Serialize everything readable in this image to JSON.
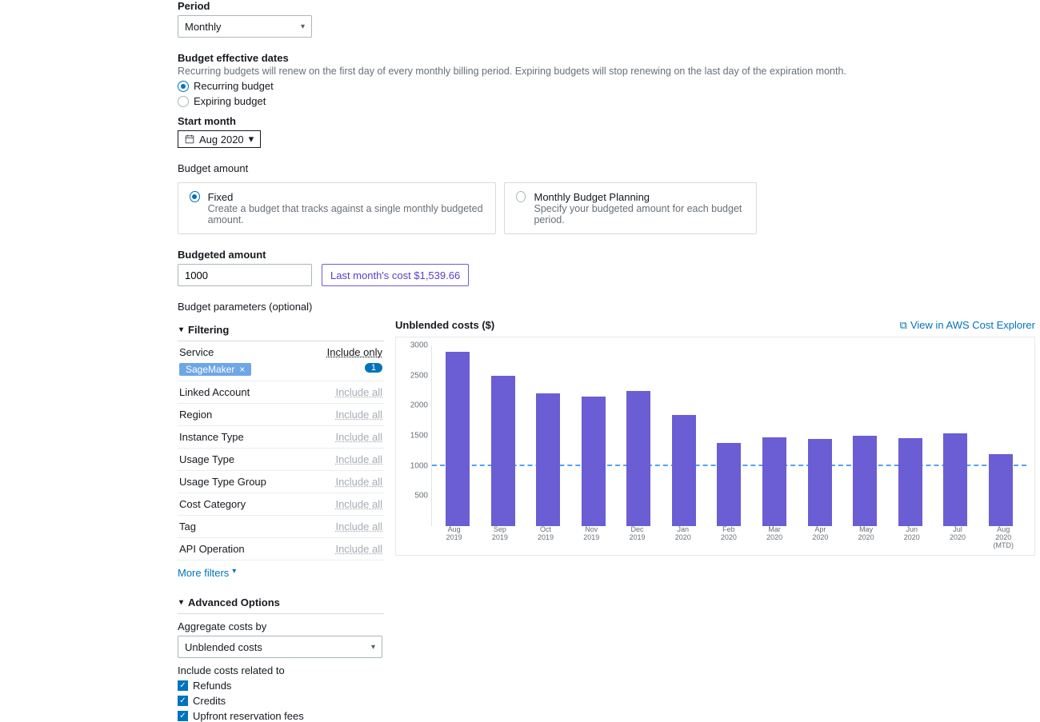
{
  "period": {
    "label": "Period",
    "value": "Monthly"
  },
  "effective_dates": {
    "label": "Budget effective dates",
    "desc": "Recurring budgets will renew on the first day of every monthly billing period. Expiring budgets will stop renewing on the last day of the expiration month.",
    "recurring": "Recurring budget",
    "expiring": "Expiring budget"
  },
  "start_month": {
    "label": "Start month",
    "value": "Aug 2020"
  },
  "budget_amount": {
    "heading": "Budget amount",
    "fixed": {
      "title": "Fixed",
      "sub": "Create a budget that tracks against a single monthly budgeted amount."
    },
    "planning": {
      "title": "Monthly Budget Planning",
      "sub": "Specify your budgeted amount for each budget period."
    }
  },
  "budgeted": {
    "label": "Budgeted amount",
    "value": "1000",
    "hint": "Last month's cost $1,539.66"
  },
  "params_label": "Budget parameters (optional)",
  "filtering": {
    "title": "Filtering",
    "service": {
      "name": "Service",
      "mode": "Include only",
      "tag": "SageMaker",
      "count": "1"
    },
    "rows": [
      {
        "name": "Linked Account",
        "mode": "Include all"
      },
      {
        "name": "Region",
        "mode": "Include all"
      },
      {
        "name": "Instance Type",
        "mode": "Include all"
      },
      {
        "name": "Usage Type",
        "mode": "Include all"
      },
      {
        "name": "Usage Type Group",
        "mode": "Include all"
      },
      {
        "name": "Cost Category",
        "mode": "Include all"
      },
      {
        "name": "Tag",
        "mode": "Include all"
      },
      {
        "name": "API Operation",
        "mode": "Include all"
      }
    ],
    "more": "More filters"
  },
  "advanced": {
    "title": "Advanced Options",
    "aggregate_label": "Aggregate costs by",
    "aggregate_value": "Unblended costs",
    "include_label": "Include costs related to",
    "items": [
      "Refunds",
      "Credits",
      "Upfront reservation fees"
    ]
  },
  "chart": {
    "title": "Unblended costs ($)",
    "explorer_link": "View in AWS Cost Explorer"
  },
  "chart_data": {
    "type": "bar",
    "title": "Unblended costs ($)",
    "xlabel": "",
    "ylabel": "",
    "ylim": [
      0,
      3000
    ],
    "budget_line": 1000,
    "categories": [
      "Aug 2019",
      "Sep 2019",
      "Oct 2019",
      "Nov 2019",
      "Dec 2019",
      "Jan 2020",
      "Feb 2020",
      "Mar 2020",
      "Apr 2020",
      "May 2020",
      "Jun 2020",
      "Jul 2020",
      "Aug 2020 (MTD)"
    ],
    "values": [
      2900,
      2500,
      2200,
      2150,
      2250,
      1850,
      1380,
      1480,
      1450,
      1500,
      1460,
      1540,
      1200
    ]
  }
}
